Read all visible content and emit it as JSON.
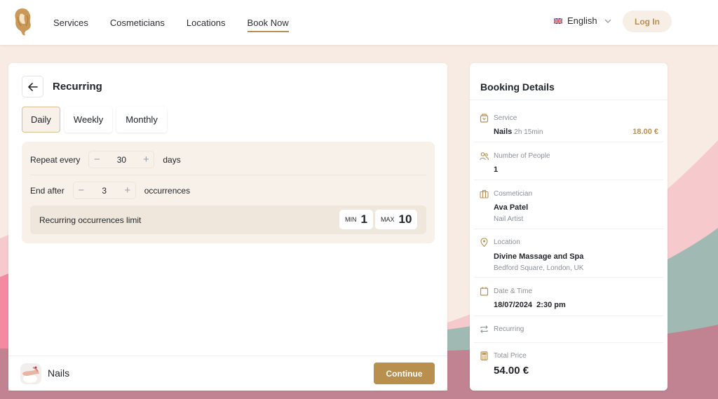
{
  "header": {
    "logo": "woman-hair-logo",
    "nav": [
      {
        "label": "Services",
        "active": false
      },
      {
        "label": "Cosmeticians",
        "active": false
      },
      {
        "label": "Locations",
        "active": false
      },
      {
        "label": "Book Now",
        "active": true
      }
    ],
    "language": "English",
    "login_label": "Log In"
  },
  "recurring": {
    "title": "Recurring",
    "tabs": [
      {
        "label": "Daily",
        "active": true
      },
      {
        "label": "Weekly",
        "active": false
      },
      {
        "label": "Monthly",
        "active": false
      }
    ],
    "repeat": {
      "label": "Repeat every",
      "value": "30",
      "unit": "days"
    },
    "end": {
      "label": "End after",
      "value": "3",
      "unit": "occurrences"
    },
    "limit": {
      "label": "Recurring occurrences limit",
      "min_label": "MIN",
      "min": "1",
      "max_label": "MAX",
      "max": "10"
    }
  },
  "footer": {
    "service_name": "Nails",
    "continue_label": "Continue"
  },
  "booking": {
    "title": "Booking Details",
    "service": {
      "label": "Service",
      "name": "Nails",
      "duration": "2h 15min",
      "price": "18.00 €"
    },
    "people": {
      "label": "Number of People",
      "value": "1"
    },
    "cosmetician": {
      "label": "Cosmetician",
      "name": "Ava Patel",
      "role": "Nail Artist"
    },
    "location": {
      "label": "Location",
      "name": "Divine Massage and Spa",
      "address": "Bedford Square, London, UK"
    },
    "datetime": {
      "label": "Date & Time",
      "value": "18/07/2024  2:30 pm"
    },
    "recurring": {
      "label": "Recurring"
    },
    "total": {
      "label": "Total Price",
      "value": "54.00 €"
    }
  },
  "colors": {
    "accent": "#b98f4e",
    "accent_light": "#f7f1ea",
    "bg_peach": "#f8ebe4",
    "wave_pink": "#f6c9cd",
    "wave_hotpink": "#f48aa0",
    "wave_teal": "#a0bab3",
    "wave_mauve": "#c18391"
  }
}
